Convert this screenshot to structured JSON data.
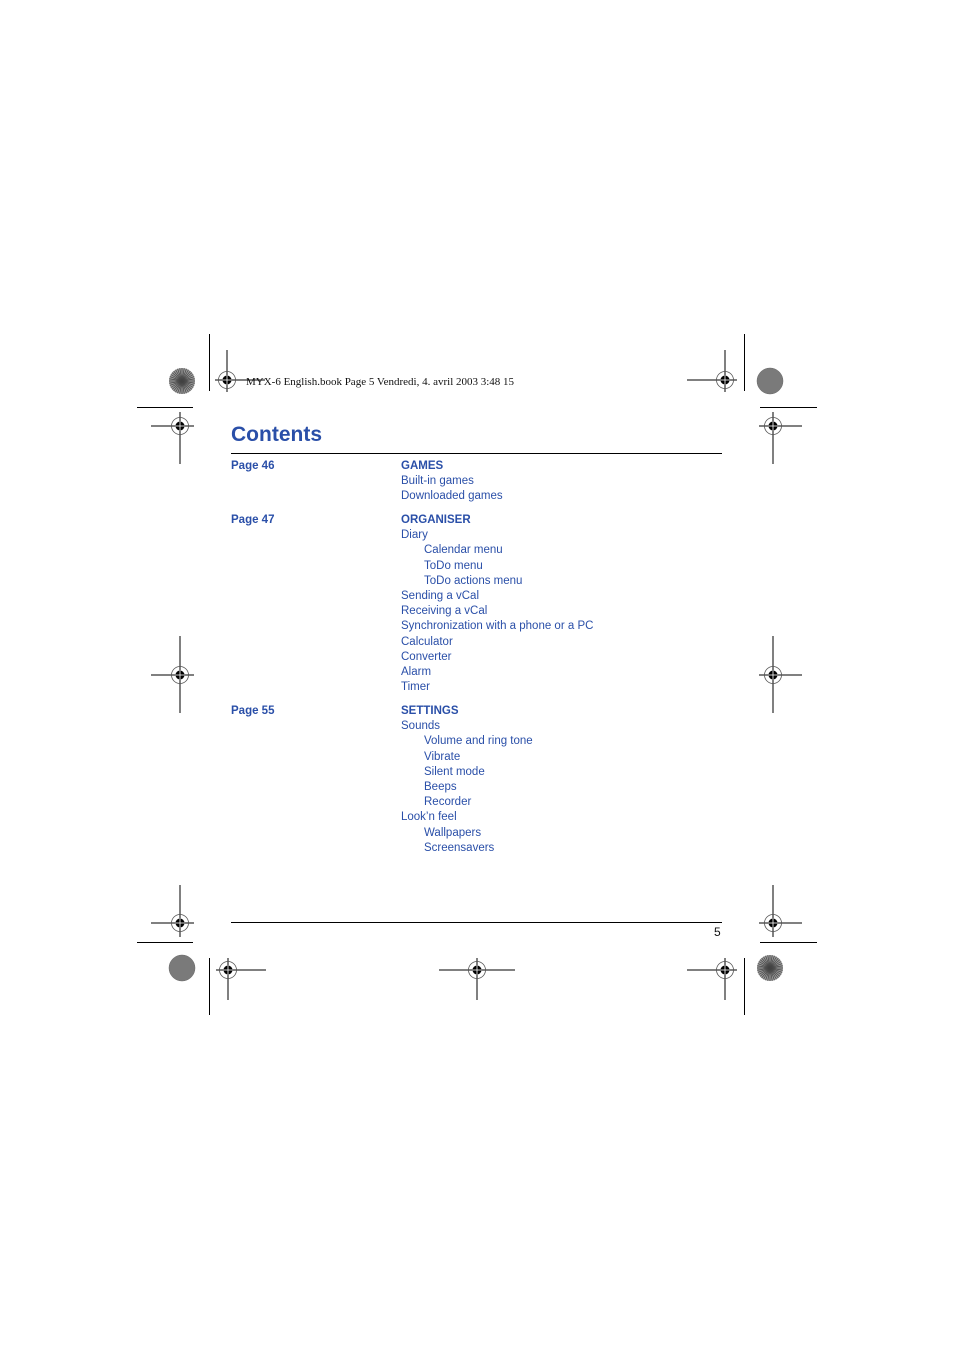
{
  "header": {
    "print_slug": "MYX-6 English.book  Page 5  Vendredi, 4. avril 2003  3:48 15"
  },
  "title": "Contents",
  "page_number": "5",
  "sections": [
    {
      "page": "Page 46",
      "heading": "GAMES",
      "entries": [
        {
          "label": "Built-in games",
          "level": 1
        },
        {
          "label": "Downloaded games",
          "level": 1
        }
      ]
    },
    {
      "page": "Page 47",
      "heading": "ORGANISER",
      "entries": [
        {
          "label": "Diary",
          "level": 1
        },
        {
          "label": "Calendar menu",
          "level": 2
        },
        {
          "label": "ToDo menu",
          "level": 2
        },
        {
          "label": "ToDo actions menu",
          "level": 2
        },
        {
          "label": "Sending a vCal",
          "level": 1
        },
        {
          "label": "Receiving a vCal",
          "level": 1
        },
        {
          "label": "Synchronization with a phone or a PC",
          "level": 1
        },
        {
          "label": "Calculator",
          "level": 1
        },
        {
          "label": "Converter",
          "level": 1
        },
        {
          "label": "Alarm",
          "level": 1
        },
        {
          "label": "Timer",
          "level": 1
        }
      ]
    },
    {
      "page": "Page 55",
      "heading": "SETTINGS",
      "entries": [
        {
          "label": "Sounds",
          "level": 1
        },
        {
          "label": "Volume and ring tone",
          "level": 2
        },
        {
          "label": "Vibrate",
          "level": 2
        },
        {
          "label": "Silent mode",
          "level": 2
        },
        {
          "label": "Beeps",
          "level": 2
        },
        {
          "label": "Recorder",
          "level": 2
        },
        {
          "label": "Look’n feel",
          "level": 1
        },
        {
          "label": "Wallpapers",
          "level": 2
        },
        {
          "label": "Screensavers",
          "level": 2
        }
      ]
    }
  ],
  "colors": {
    "accent": "#2a4fa8",
    "text": "#111111"
  }
}
